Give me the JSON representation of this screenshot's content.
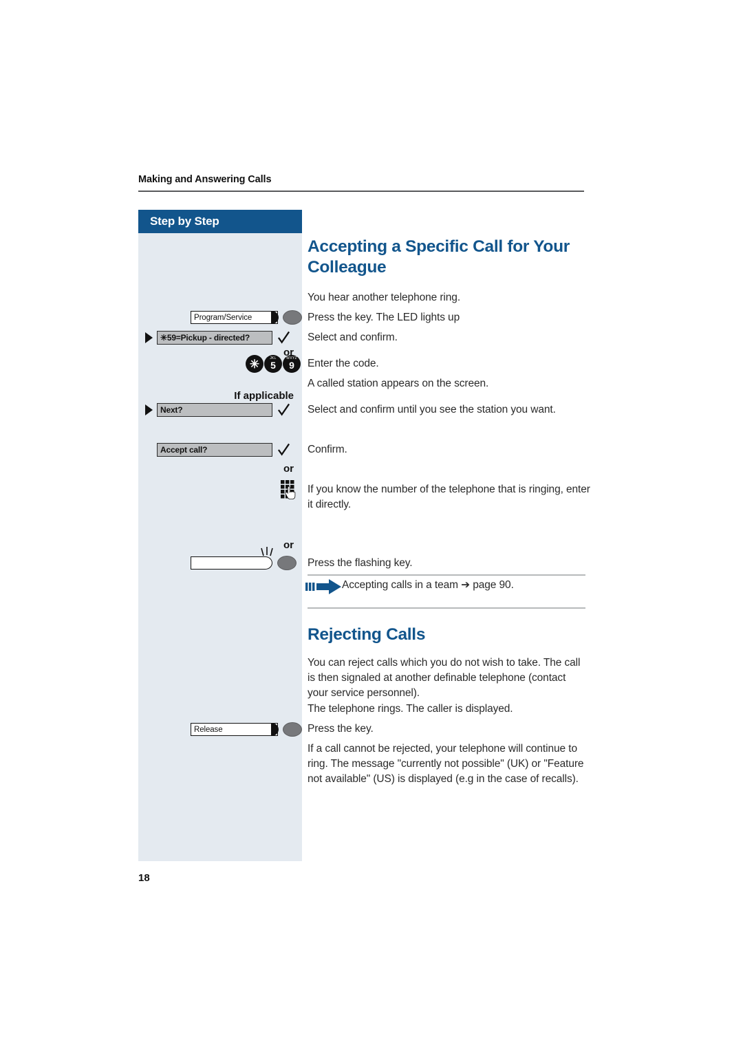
{
  "document": {
    "running_header": "Making and Answering Calls",
    "page_number": "18"
  },
  "sidebar": {
    "title": "Step by Step",
    "if_applicable_caption": "If applicable",
    "or_label_1": "or",
    "or_label_2": "or",
    "or_label_3": "or",
    "function_keys": [
      {
        "name": "program-service-key",
        "label": "Program/Service"
      },
      {
        "name": "release-key",
        "label": "Release"
      }
    ],
    "display_rows": [
      {
        "name": "pickup-directed-option",
        "text": "✳59=Pickup - directed?",
        "has_caret": true
      },
      {
        "name": "next-option",
        "text": "Next?",
        "has_caret": true
      },
      {
        "name": "accept-call-option",
        "text": "Accept call?",
        "has_caret": false
      }
    ],
    "keypad_digits": [
      {
        "sub": "",
        "main": "✳"
      },
      {
        "sub": "JKL",
        "main": "5"
      },
      {
        "sub": "WXYZ",
        "main": "9"
      }
    ]
  },
  "content": {
    "section_1": {
      "title": "Accepting a Specific Call for Your Colleague",
      "steps": [
        "You hear another telephone ring.",
        "Press the key. The LED lights up",
        "Select and confirm.",
        "Enter the code.",
        "A called station appears on the screen.",
        "Select and confirm until you see the station you want.",
        "Confirm.",
        "If you know the number of the telephone that is ringing, enter it directly.",
        "Press the flashing key."
      ],
      "cross_reference": "Accepting calls in a team ➔ page 90."
    },
    "section_2": {
      "title": "Rejecting Calls",
      "paragraphs": [
        "You can reject calls which you do not wish to take. The call is then signaled at another definable telephone (contact your service personnel).",
        "The telephone rings. The caller is displayed.",
        "Press the key.",
        "If a call cannot be rejected, your telephone will continue to ring. The message \"currently not possible\" (UK) or \"Feature not available\" (US) is displayed (e.g in the case of recalls)."
      ]
    }
  },
  "colors": {
    "brand_blue": "#12558c",
    "sidebar_bg": "#e4eaf0",
    "display_field": "#bcbec0",
    "rule_gray": "#58595b"
  }
}
